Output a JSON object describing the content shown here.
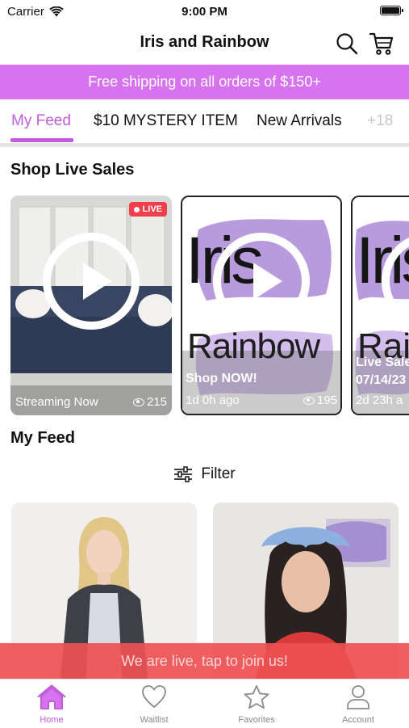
{
  "status_bar": {
    "carrier": "Carrier",
    "time": "9:00 PM"
  },
  "header": {
    "title": "Iris and Rainbow"
  },
  "promo": {
    "text": "Free shipping on all orders of $150+"
  },
  "tabs": [
    {
      "label": "My Feed",
      "active": true
    },
    {
      "label": "$10 MYSTERY ITEM"
    },
    {
      "label": "New Arrivals"
    },
    {
      "label": "+18"
    }
  ],
  "live_section": {
    "title": "Shop Live Sales",
    "cards": [
      {
        "badge": "LIVE",
        "status": "Streaming Now",
        "views": "215"
      },
      {
        "logo_top": "Iris",
        "logo_bottom": "Rainbow",
        "caption": "Shop NOW!",
        "status": "1d 0h ago",
        "views": "195"
      },
      {
        "logo_top": "Iris",
        "logo_bottom": "Rain",
        "caption_line1": "Live Sale",
        "caption_line2": "07/14/23",
        "status": "2d 23h a"
      }
    ]
  },
  "feed_section": {
    "title": "My Feed",
    "filter_label": "Filter"
  },
  "live_banner": {
    "text": "We are live, tap to join us!"
  },
  "tab_bar": [
    {
      "label": "Home",
      "active": true
    },
    {
      "label": "Waitlist"
    },
    {
      "label": "Favorites"
    },
    {
      "label": "Account"
    }
  ],
  "colors": {
    "accent": "#c15ddb",
    "promo_bg": "#d773ee",
    "live_red": "#f03f4a"
  }
}
